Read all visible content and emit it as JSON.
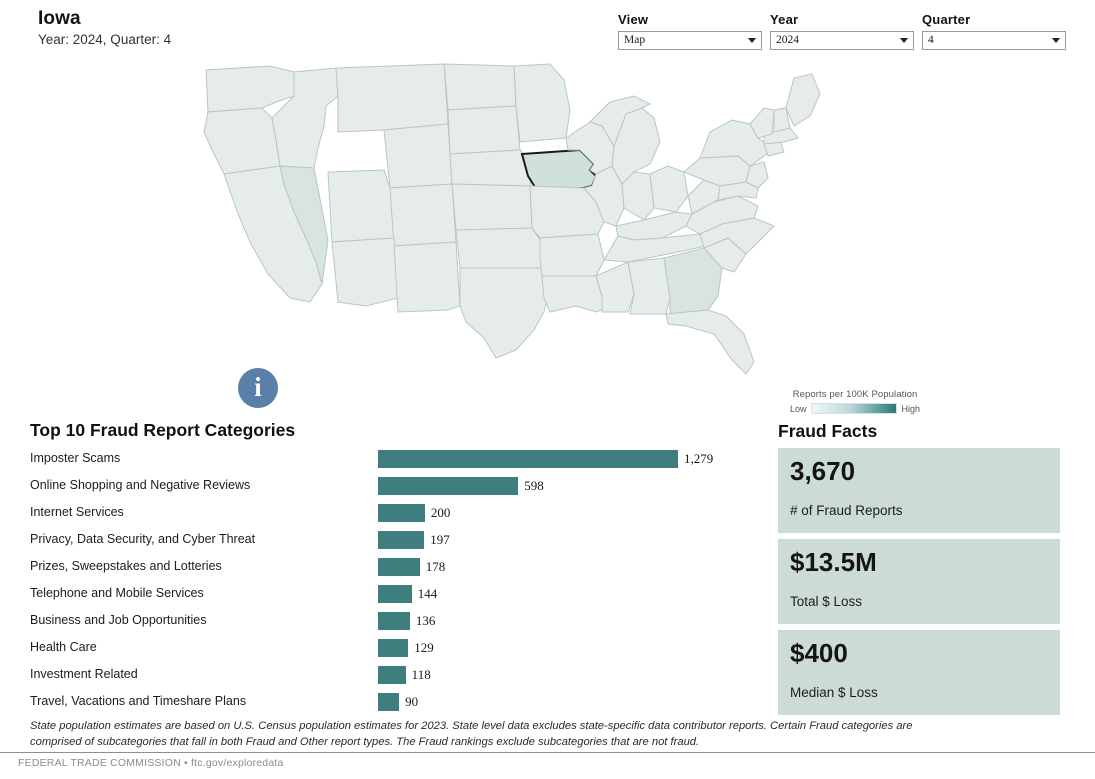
{
  "header": {
    "state": "Iowa",
    "subtitle": "Year: 2024, Quarter: 4"
  },
  "controls": [
    {
      "label": "View",
      "value": "Map",
      "name": "view"
    },
    {
      "label": "Year",
      "value": "2024",
      "name": "year"
    },
    {
      "label": "Quarter",
      "value": "4",
      "name": "quarter"
    }
  ],
  "map": {
    "selected_state": "Iowa",
    "info_icon": "info-icon",
    "legend": {
      "title": "Reports per 100K Population",
      "low": "Low",
      "high": "High",
      "gradient_low": "#f2f7f7",
      "gradient_high": "#2c7a7a"
    },
    "state_fill": "#e6ecec",
    "selected_fill": "#cfe0dd",
    "border": "#b9c6c6"
  },
  "chart_data": {
    "type": "bar",
    "title": "Top 10 Fraud Report Categories",
    "xlabel": "",
    "ylabel": "",
    "orientation": "horizontal",
    "bar_color": "#3e7e7e",
    "xlim": [
      0,
      1279
    ],
    "categories": [
      "Imposter Scams",
      "Online Shopping and Negative Reviews",
      "Internet Services",
      "Privacy, Data Security, and Cyber Threat",
      "Prizes, Sweepstakes and Lotteries",
      "Telephone and Mobile Services",
      "Business and Job Opportunities",
      "Health Care",
      "Investment Related",
      "Travel, Vacations and Timeshare Plans"
    ],
    "values": [
      1279,
      598,
      200,
      197,
      178,
      144,
      136,
      129,
      118,
      90
    ],
    "value_labels": [
      "1,279",
      "598",
      "200",
      "197",
      "178",
      "144",
      "136",
      "129",
      "118",
      "90"
    ]
  },
  "facts": {
    "title": "Fraud Facts",
    "cards": [
      {
        "value": "3,670",
        "label": "# of Fraud Reports"
      },
      {
        "value": "$13.5M",
        "label": "Total $ Loss"
      },
      {
        "value": "$400",
        "label": "Median $ Loss"
      }
    ],
    "card_color": "#ccdbd5"
  },
  "footnote": "State population estimates are based on U.S. Census population estimates for 2023. State level data excludes state-specific data contributor reports. Certain Fraud categories are comprised of subcategories that fall in both Fraud and Other report types. The Fraud rankings exclude subcategories that are not fraud.",
  "footer": "FEDERAL TRADE COMMISSION • ftc.gov/exploredata"
}
